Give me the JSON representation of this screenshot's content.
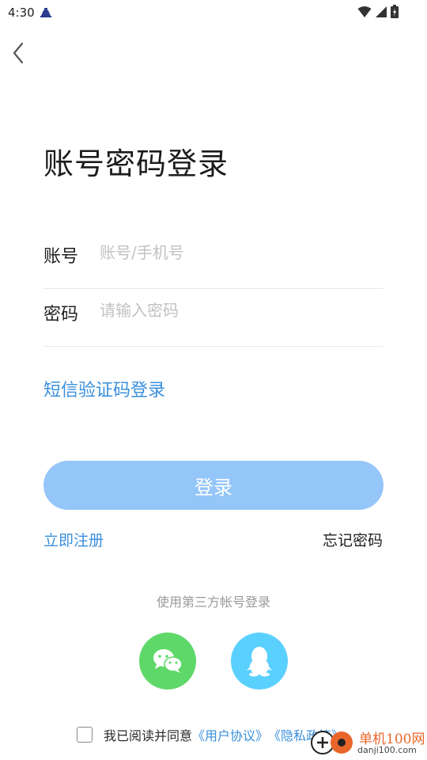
{
  "status_bar": {
    "time": "4:30"
  },
  "header": {
    "title": "账号密码登录"
  },
  "form": {
    "account": {
      "label": "账号",
      "placeholder": "账号/手机号",
      "value": ""
    },
    "password": {
      "label": "密码",
      "placeholder": "请输入密码",
      "value": ""
    }
  },
  "links": {
    "sms_login": "短信验证码登录",
    "register": "立即注册",
    "forgot_password": "忘记密码"
  },
  "actions": {
    "login_label": "登录"
  },
  "third_party": {
    "title": "使用第三方帐号登录",
    "providers": [
      "wechat-icon",
      "qq-icon"
    ]
  },
  "agreement": {
    "prefix": "我已阅读并同意",
    "user_agreement": "《用户协议》",
    "privacy_policy": "《隐私政策》",
    "checked": false
  },
  "watermark": {
    "cn": "单机100网",
    "en": "danji100.com"
  },
  "colors": {
    "primary_link": "#3a8fdc",
    "login_button": "#95c6f9",
    "wechat": "#5fd86a",
    "qq": "#5ad0ff"
  }
}
